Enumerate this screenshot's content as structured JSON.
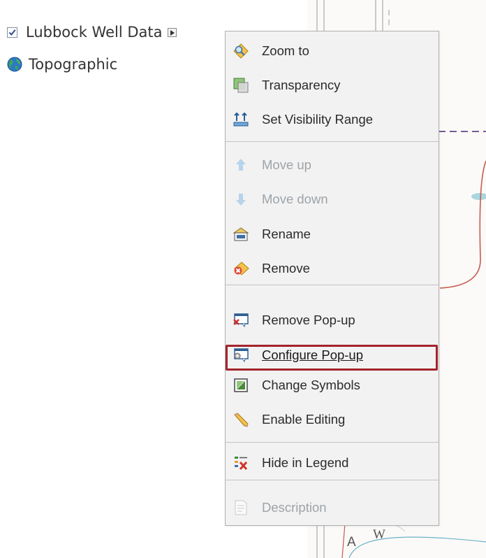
{
  "layers": [
    {
      "label": "Lubbock Well Data",
      "checked": true
    },
    {
      "label": "Topographic"
    }
  ],
  "context_menu": {
    "items": [
      {
        "label": "Zoom to",
        "icon": "zoom-to-icon",
        "enabled": true
      },
      {
        "label": "Transparency",
        "icon": "transparency-icon",
        "enabled": true
      },
      {
        "label": "Set Visibility Range",
        "icon": "visibility-range-icon",
        "enabled": true
      },
      {
        "label": "Move up",
        "icon": "arrow-up-icon",
        "enabled": false
      },
      {
        "label": "Move down",
        "icon": "arrow-down-icon",
        "enabled": false
      },
      {
        "label": "Rename",
        "icon": "rename-icon",
        "enabled": true
      },
      {
        "label": "Remove",
        "icon": "remove-icon",
        "enabled": true
      },
      {
        "label": "Remove Pop-up",
        "icon": "remove-popup-icon",
        "enabled": true
      },
      {
        "label": "Configure Pop-up",
        "icon": "configure-popup-icon",
        "enabled": true,
        "highlighted": true
      },
      {
        "label": "Change Symbols",
        "icon": "change-symbols-icon",
        "enabled": true
      },
      {
        "label": "Enable Editing",
        "icon": "pencil-icon",
        "enabled": true
      },
      {
        "label": "Hide in Legend",
        "icon": "hide-legend-icon",
        "enabled": true
      },
      {
        "label": "Description",
        "icon": "description-icon",
        "enabled": false
      }
    ],
    "highlight_color": "#a4242c"
  },
  "map": {
    "labels": [
      "A",
      "W"
    ]
  }
}
